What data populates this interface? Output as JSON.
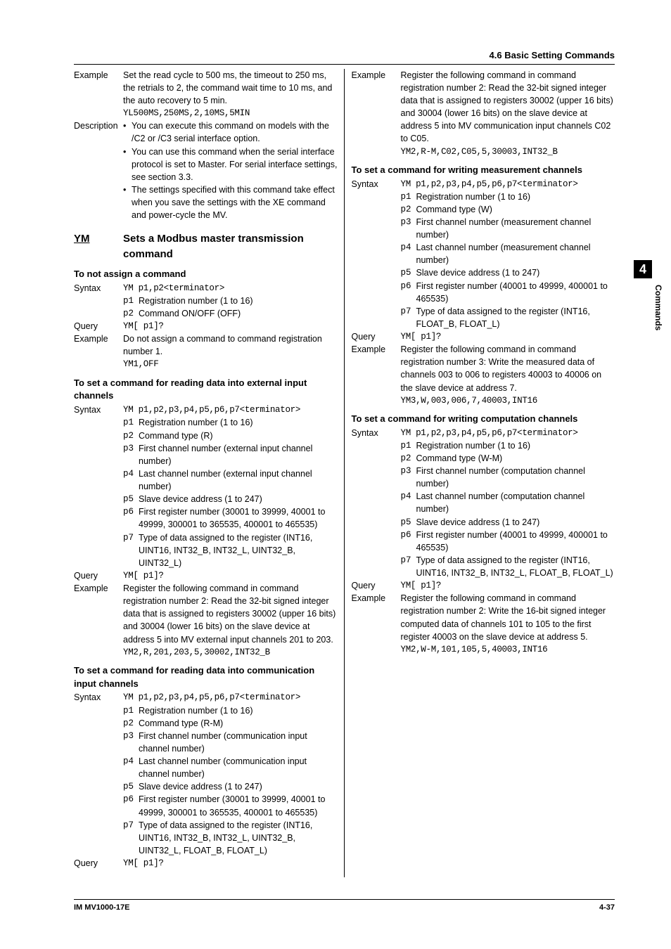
{
  "sectionHeader": "4.6  Basic Setting Commands",
  "tab": {
    "num": "4",
    "label": "Commands"
  },
  "footer": {
    "left": "IM MV1000-17E",
    "right": "4-37"
  },
  "s1": {
    "ex_label": "Example",
    "ex_l1": "Set the read cycle to 500 ms, the timeout to 250 ms, the retrials to 2, the command wait time to 10 ms, and the auto recovery to 5 min.",
    "ex_code": "YL500MS,250MS,2,10MS,5MIN",
    "desc_label": "Description",
    "b1": "You can execute this command on models with the /C2 or /C3 serial interface option.",
    "b2": "You can use this command when the serial interface protocol is set to Master. For serial interface settings, see section 3.3.",
    "b3": "The settings specified with this command take effect when you save the settings with the XE command and power-cycle the MV."
  },
  "ym": {
    "mnemonic": "YM",
    "title": "Sets a Modbus master transmission command"
  },
  "notAssign": {
    "head": "To not assign a command",
    "syn_label": "Syntax",
    "syn": "YM p1,p2<terminator>",
    "p1c": "p1",
    "p1": "Registration number (1 to 16)",
    "p2c": "p2",
    "p2": "Command ON/OFF (OFF)",
    "q_label": "Query",
    "q": "YM[ p1]?",
    "ex_label": "Example",
    "ex": "Do not assign a command to command registration number 1.",
    "ex_code": "YM1,OFF"
  },
  "readExt": {
    "head": "To set a command for reading data into external input channels",
    "syn_label": "Syntax",
    "syn": "YM p1,p2,p3,p4,p5,p6,p7<terminator>",
    "p1c": "p1",
    "p1": "Registration number (1 to 16)",
    "p2c": "p2",
    "p2": "Command type (R)",
    "p3c": "p3",
    "p3": "First channel number (external input channel number)",
    "p4c": "p4",
    "p4": "Last channel number (external input channel number)",
    "p5c": "p5",
    "p5": "Slave device address (1 to 247)",
    "p6c": "p6",
    "p6": "First register number (30001 to 39999, 40001 to 49999, 300001 to 365535, 400001 to 465535)",
    "p7c": "p7",
    "p7": "Type of data assigned to the register (INT16, UINT16, INT32_B, INT32_L, UINT32_B, UINT32_L)",
    "q_label": "Query",
    "q": "YM[ p1]?",
    "ex_label": "Example",
    "ex": "Register the following command in command registration number 2: Read the 32-bit signed integer data that is assigned to registers 30002 (upper 16 bits) and 30004 (lower 16 bits) on the slave device at address 5 into MV external input channels 201 to 203.",
    "ex_code": "YM2,R,201,203,5,30002,INT32_B"
  },
  "readComm": {
    "head": "To set a command for reading data into communication input channels",
    "syn_label": "Syntax",
    "syn": "YM p1,p2,p3,p4,p5,p6,p7<terminator>",
    "p1c": "p1",
    "p1": "Registration number (1 to 16)",
    "p2c": "p2",
    "p2": "Command type (R-M)",
    "p3c": "p3",
    "p3": "First channel number (communication input channel number)",
    "p4c": "p4",
    "p4": "Last channel number (communication input channel number)",
    "p5c": "p5",
    "p5": "Slave device address (1 to 247)",
    "p6c": "p6",
    "p6": "First register number (30001 to 39999, 40001 to 49999, 300001 to 365535, 400001 to 465535)",
    "p7c": "p7",
    "p7": "Type of data assigned to the register (INT16, UINT16, INT32_B, INT32_L, UINT32_B, UINT32_L, FLOAT_B, FLOAT_L)",
    "q_label": "Query",
    "q": "YM[ p1]?",
    "ex_label": "Example",
    "ex": "Register the following command in command registration number 2: Read the 32-bit signed integer data that is assigned to registers 30002 (upper 16 bits) and 30004 (lower 16 bits) on the slave device at address 5 into MV communication input channels C02 to C05.",
    "ex_code": "YM2,R-M,C02,C05,5,30003,INT32_B"
  },
  "writeMeas": {
    "head": "To set a command for writing measurement channels",
    "syn_label": "Syntax",
    "syn": "YM p1,p2,p3,p4,p5,p6,p7<terminator>",
    "p1c": "p1",
    "p1": "Registration number (1 to 16)",
    "p2c": "p2",
    "p2": "Command type (W)",
    "p3c": "p3",
    "p3": "First channel number (measurement channel number)",
    "p4c": "p4",
    "p4": "Last channel number (measurement channel number)",
    "p5c": "p5",
    "p5": "Slave device address (1 to 247)",
    "p6c": "p6",
    "p6": "First register number (40001 to 49999, 400001 to 465535)",
    "p7c": "p7",
    "p7": "Type of data assigned to the register (INT16, FLOAT_B, FLOAT_L)",
    "q_label": "Query",
    "q": "YM[ p1]?",
    "ex_label": "Example",
    "ex": "Register the following command in command registration number 3: Write the measured data of channels 003 to 006 to registers 40003 to 40006 on the slave device at address 7.",
    "ex_code": "YM3,W,003,006,7,40003,INT16"
  },
  "writeComp": {
    "head": "To set a command for writing computation channels",
    "syn_label": "Syntax",
    "syn": "YM p1,p2,p3,p4,p5,p6,p7<terminator>",
    "p1c": "p1",
    "p1": "Registration number (1 to 16)",
    "p2c": "p2",
    "p2": "Command type (W-M)",
    "p3c": "p3",
    "p3": "First channel number (computation channel number)",
    "p4c": "p4",
    "p4": "Last channel number (computation channel number)",
    "p5c": "p5",
    "p5": "Slave device address (1 to 247)",
    "p6c": "p6",
    "p6": "First register number (40001 to 49999, 400001 to 465535)",
    "p7c": "p7",
    "p7": "Type of data assigned to the register (INT16, UINT16, INT32_B, INT32_L, FLOAT_B, FLOAT_L)",
    "q_label": "Query",
    "q": "YM[ p1]?",
    "ex_label": "Example",
    "ex": "Register the following command in command registration number 2: Write the 16-bit signed integer computed data of channels 101 to 105 to the first register 40003 on the slave device at address 5.",
    "ex_code": "YM2,W-M,101,105,5,40003,INT16"
  }
}
